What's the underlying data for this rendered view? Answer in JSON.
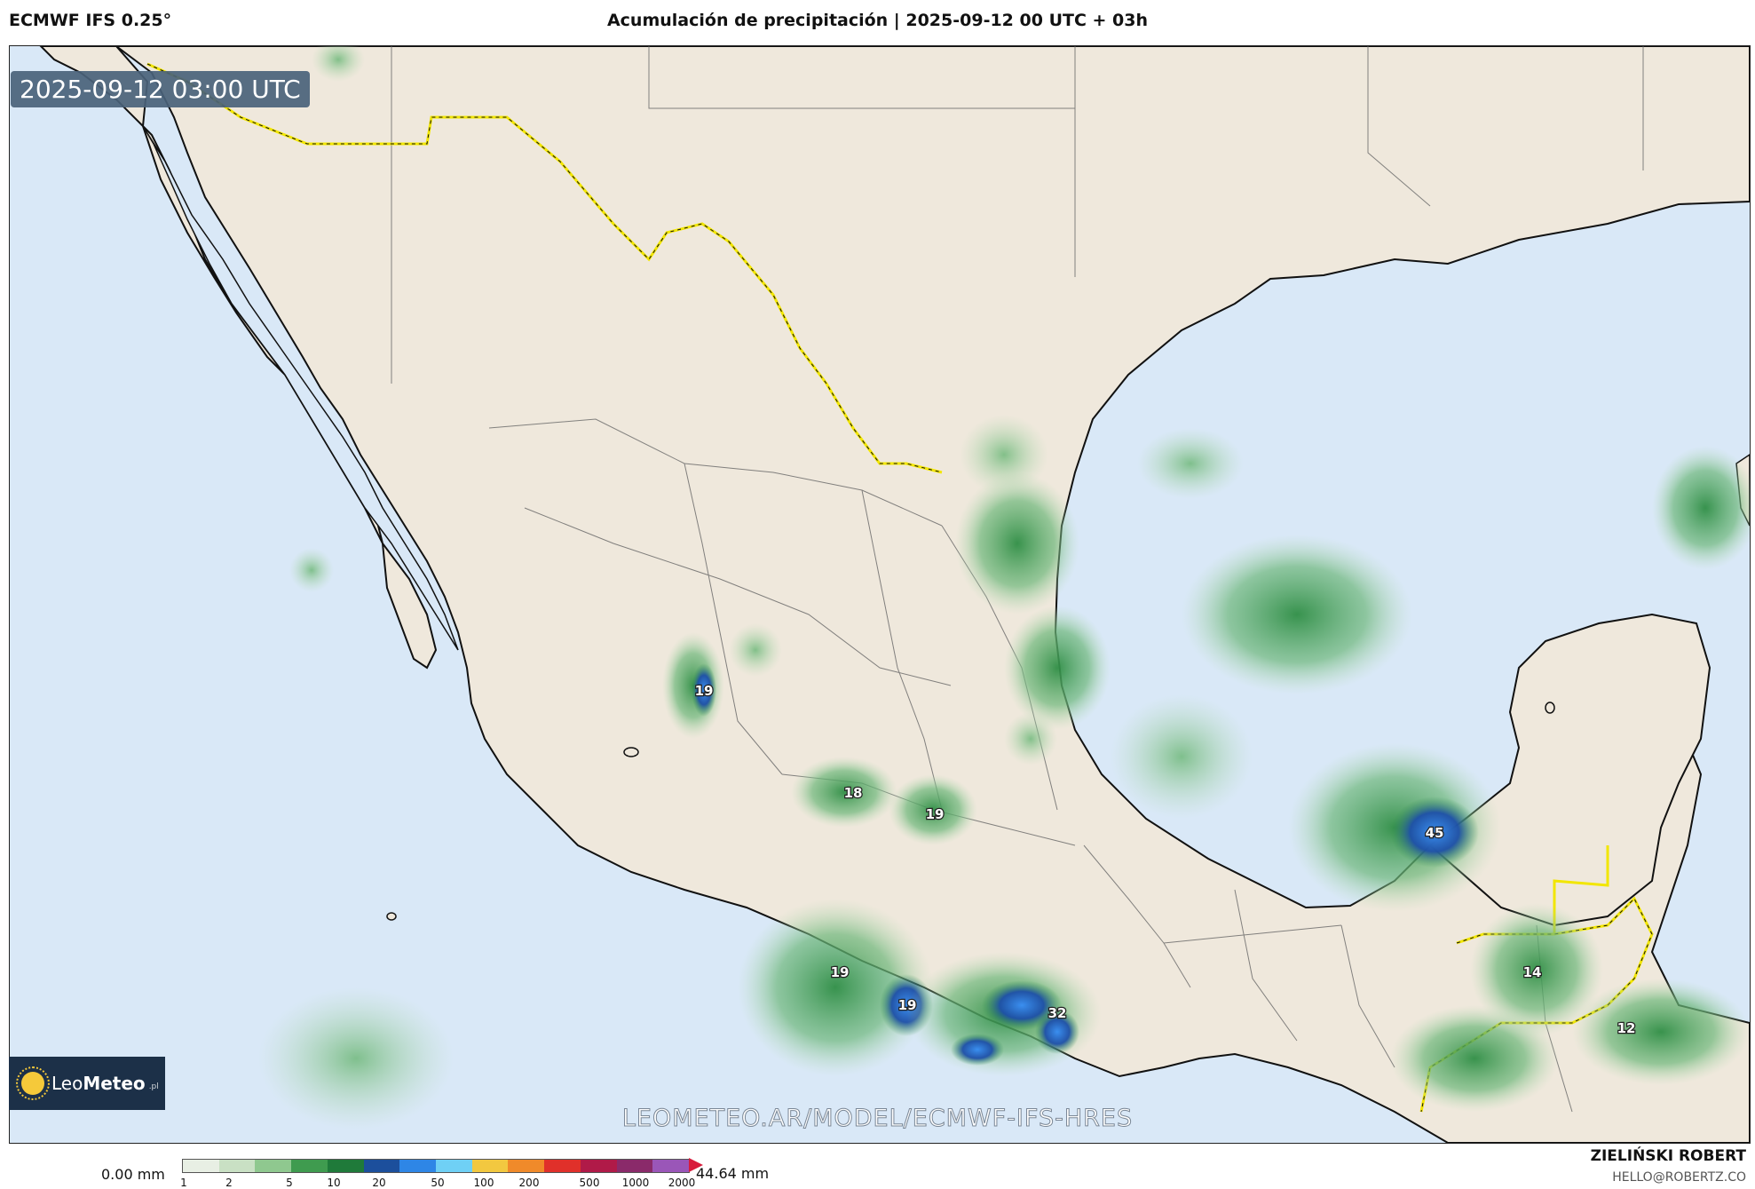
{
  "header": {
    "model": "ECMWF IFS 0.25°",
    "title": "Acumulación de precipitación | 2025-09-12 00 UTC + 03h"
  },
  "map": {
    "timestamp": "2025-09-12 03:00 UTC",
    "watermark": "LEOMETEO.AR/MODEL/ECMWF-IFS-HRES",
    "colors": {
      "ocean": "#d9e8f7",
      "land": "#efe8dc",
      "border": "#f2e600",
      "coast": "#111111",
      "state_lines": "#555555"
    },
    "precip_labels": [
      {
        "id": "jalisco-coast",
        "value": "19"
      },
      {
        "id": "michoacan-a",
        "value": "18"
      },
      {
        "id": "michoacan-b",
        "value": "19"
      },
      {
        "id": "guerrero-a",
        "value": "19"
      },
      {
        "id": "guerrero-b",
        "value": "19"
      },
      {
        "id": "oaxaca-coast",
        "value": "32"
      },
      {
        "id": "campeche-bay",
        "value": "45"
      },
      {
        "id": "peten",
        "value": "14"
      },
      {
        "id": "belize-honduras",
        "value": "12"
      }
    ]
  },
  "logo": {
    "name_light": "Leo",
    "name_bold": "Meteo",
    "suffix": ".pl"
  },
  "legend": {
    "min_label": "0.00 mm",
    "max_label": "44.64 mm",
    "ticks": [
      "1",
      "2",
      "5",
      "10",
      "20",
      "50",
      "100",
      "200",
      "500",
      "1000",
      "2000"
    ],
    "colors": [
      "#e8efe4",
      "#c9e0c4",
      "#8fc88f",
      "#3f9b4f",
      "#1f7a3a",
      "#1c4f9c",
      "#2e86e6",
      "#6fd0f5",
      "#f2c840",
      "#f08a2a",
      "#e0302a",
      "#b01a48",
      "#8a2a6a",
      "#9a56b8"
    ]
  },
  "footer": {
    "author": "ZIELIŃSKI ROBERT",
    "email": "HELLO@ROBERTZ.CO"
  }
}
